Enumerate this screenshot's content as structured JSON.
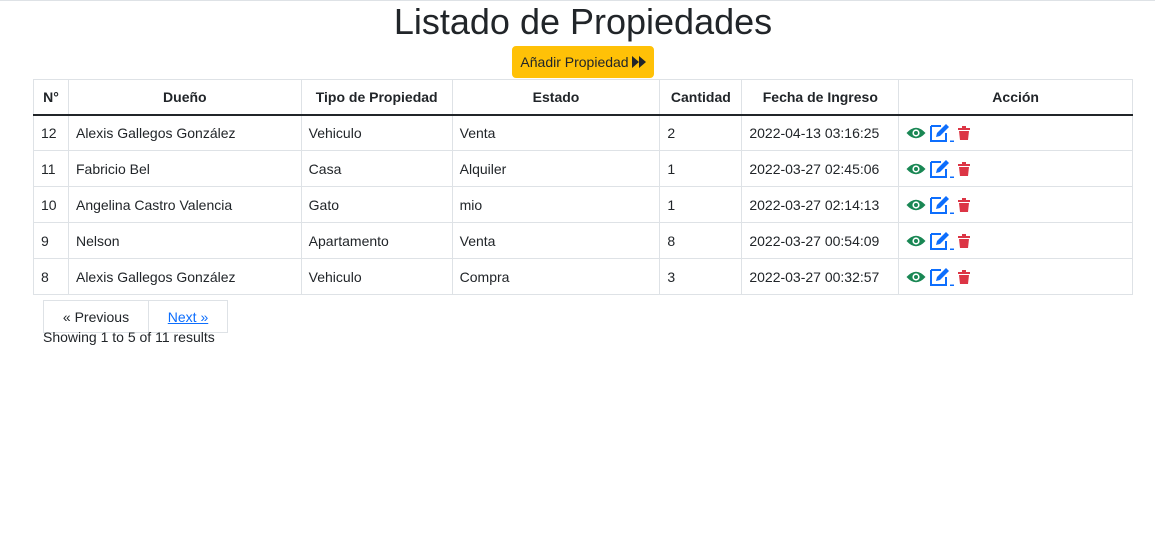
{
  "page": {
    "title": "Listado de Propiedades"
  },
  "toolbar": {
    "add_label": "Añadir Propiedad",
    "add_icon": "fast-forward-icon"
  },
  "table": {
    "headers": [
      "N°",
      "Dueño",
      "Tipo de Propiedad",
      "Estado",
      "Cantidad",
      "Fecha de Ingreso",
      "Acción"
    ],
    "rows": [
      {
        "num": "12",
        "owner": "Alexis Gallegos González",
        "type": "Vehiculo",
        "status": "Venta",
        "qty": "2",
        "date": "2022-04-13 03:16:25"
      },
      {
        "num": "11",
        "owner": "Fabricio Bel",
        "type": "Casa",
        "status": "Alquiler",
        "qty": "1",
        "date": "2022-03-27 02:45:06"
      },
      {
        "num": "10",
        "owner": "Angelina Castro Valencia",
        "type": "Gato",
        "status": "mio",
        "qty": "1",
        "date": "2022-03-27 02:14:13"
      },
      {
        "num": "9",
        "owner": "Nelson",
        "type": "Apartamento",
        "status": "Venta",
        "qty": "8",
        "date": "2022-03-27 00:54:09"
      },
      {
        "num": "8",
        "owner": "Alexis Gallegos González",
        "type": "Vehiculo",
        "status": "Compra",
        "qty": "3",
        "date": "2022-03-27 00:32:57"
      }
    ],
    "action_icons": [
      "eye-icon",
      "edit-icon",
      "trash-icon"
    ]
  },
  "pagination": {
    "previous": "« Previous",
    "next": "Next »",
    "summary": "Showing 1 to 5 of 11 results"
  },
  "colors": {
    "view": "#198754",
    "edit": "#0d6efd",
    "delete": "#dc3545",
    "warning": "#ffc107"
  }
}
